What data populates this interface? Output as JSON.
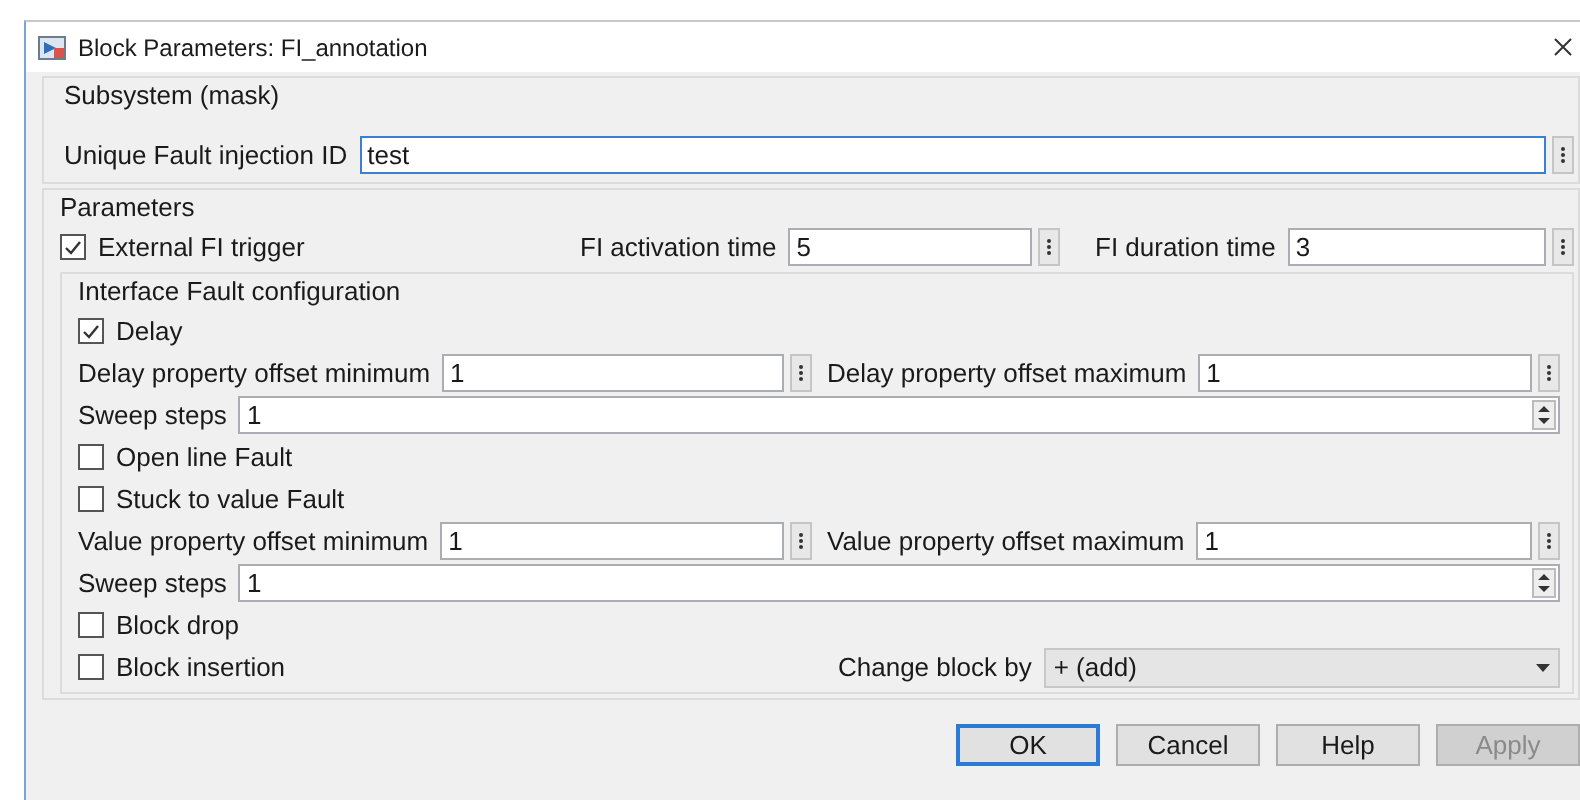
{
  "window": {
    "title": "Block Parameters: FI_annotation"
  },
  "mask": {
    "title": "Subsystem (mask)",
    "field": {
      "label": "Unique Fault injection ID",
      "value": "test",
      "focused": true
    }
  },
  "parameters": {
    "title": "Parameters",
    "trigger": {
      "label": "External FI trigger",
      "checked": true
    },
    "activation": {
      "label": "FI activation time",
      "value": "5"
    },
    "duration": {
      "label": "FI duration time",
      "value": "3"
    },
    "group": {
      "title": "Interface Fault configuration",
      "rows": [
        {
          "kind": "checkbox",
          "label": "Delay",
          "checked": true
        },
        {
          "kind": "pair",
          "fields": [
            {
              "label": "Delay property offset minimum",
              "value": "1"
            },
            {
              "label": "Delay property offset maximum",
              "value": "1"
            }
          ]
        },
        {
          "kind": "spin",
          "label": "Sweep steps",
          "value": "1"
        },
        {
          "kind": "checkbox",
          "label": "Open line Fault",
          "checked": false
        },
        {
          "kind": "checkbox",
          "label": "Stuck to value Fault",
          "checked": false
        },
        {
          "kind": "pair",
          "fields": [
            {
              "label": "Value property offset minimum",
              "value": "1"
            },
            {
              "label": "Value property offset maximum",
              "value": "1"
            }
          ]
        },
        {
          "kind": "spin",
          "label": "Sweep steps",
          "value": "1"
        },
        {
          "kind": "checkbox",
          "label": "Block drop",
          "checked": false
        },
        {
          "kind": "checkbox_select",
          "label": "Block insertion",
          "checked": false,
          "select": {
            "label": "Change block by",
            "value": "+ (add)"
          }
        }
      ]
    }
  },
  "buttons": [
    {
      "label": "OK",
      "default": true,
      "disabled": false
    },
    {
      "label": "Cancel",
      "default": false,
      "disabled": false
    },
    {
      "label": "Help",
      "default": false,
      "disabled": false
    },
    {
      "label": "Apply",
      "default": false,
      "disabled": true
    }
  ]
}
